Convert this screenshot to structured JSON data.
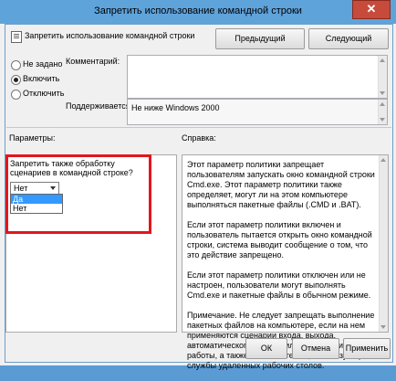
{
  "window": {
    "title": "Запретить использование командной строки",
    "close_glyph": "✕"
  },
  "header": {
    "policy_name": "Запретить использование командной строки",
    "prev_button": "Предыдущий параметр",
    "next_button": "Следующий параметр"
  },
  "state": {
    "options": [
      "Не задано",
      "Включить",
      "Отключить"
    ],
    "selected": "Включить"
  },
  "comment": {
    "label": "Комментарий:",
    "value": ""
  },
  "supported": {
    "label": "Поддерживается:",
    "value": "Не ниже Windows 2000"
  },
  "sections": {
    "params_label": "Параметры:",
    "help_label": "Справка:"
  },
  "params": {
    "question": "Запретить также обработку сценариев в командной строке?",
    "selected_value": "Нет",
    "dropdown_options": [
      "Да",
      "Нет"
    ],
    "highlighted_option": "Да"
  },
  "help": {
    "paragraphs": [
      "Этот параметр политики запрещает пользователям запускать окно командной строки Cmd.exe. Этот параметр политики также определяет, могут ли на этом компьютере выполняться пакетные файлы (.CMD и .BAT).",
      "Если этот параметр политики включен и пользователь пытается открыть окно командной строки, система выводит сообщение о том, что это действие запрещено.",
      "Если этот параметр политики отключен или не настроен, пользователи могут выполнять Cmd.exe и пакетные файлы в обычном режиме.",
      "Примечание. Не следует запрещать выполнение пакетных файлов на компьютере, если на нем применяются сценарии входа, выхода, автоматического запуска или завершения работы, а также пользователям, использующим службы удаленных рабочих столов."
    ]
  },
  "footer": {
    "ok": "ОК",
    "cancel": "Отмена",
    "apply": "Применить"
  },
  "colors": {
    "titlebar": "#5fa3db",
    "close": "#c74b3a",
    "highlight_frame": "#e3151e",
    "selection": "#3399ff"
  }
}
